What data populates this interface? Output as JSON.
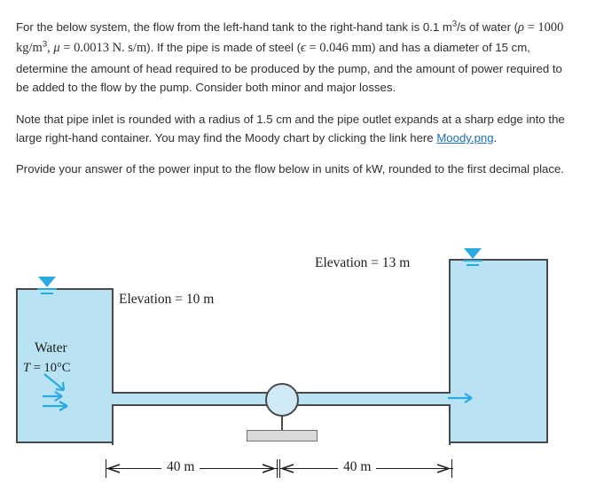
{
  "problem": {
    "para1_a": "For the below system, the flow from the left-hand tank to the right-hand tank is 0.1 m",
    "para1_sup1": "3",
    "para1_b": "/s of water (",
    "rho_sym": "ρ",
    "rho_eq": " = 1000 kg/m",
    "rho_sup": "3",
    "rho_tail": ",  ",
    "mu_sym": "μ",
    "mu_eq": " = 0.0013 N. s/m",
    "para1_c": "). If the pipe is made of steel (",
    "eps_sym": "ϵ",
    "eps_eq": " = 0.046 mm",
    "para1_d": ") and has a diameter of 15 cm, determine the amount of head required to be produced by the pump, and the amount of power required to be added to the flow by the pump. Consider both minor and major losses.",
    "para2_a": "Note that pipe inlet is rounded with a radius of 1.5 cm and the pipe outlet expands at a sharp edge into the large right-hand container. You may find the Moody chart by clicking the link here",
    "moody_link": "Moody.png",
    "para2_b": ".",
    "para3": "Provide your answer of the power input to the flow below in units of kW, rounded to the first decimal place."
  },
  "figure": {
    "elevation_right": "Elevation = 13 m",
    "elevation_left": "Elevation = 10 m",
    "fluid_label": "Water",
    "temp_label_math": "T",
    "temp_label_value": " = 10°C",
    "dim_left": "40 m",
    "dim_right": "40 m",
    "colors": {
      "water": "#b9e2f2",
      "outline": "#4a4a4a",
      "symbol_blue": "#29abe2",
      "pump_base": "#d9d9d9",
      "link": "#1a6fb5"
    }
  }
}
